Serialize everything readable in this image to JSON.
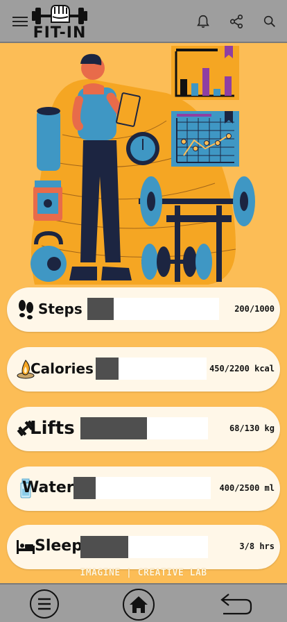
{
  "app": {
    "title": "FIT-IN",
    "footer": "IMAGINE | CREATIVE LAB"
  },
  "colors": {
    "background": "#fcbd56",
    "bar": "#9e9e9e",
    "card": "#fff7e8",
    "fill": "#4f4f4f",
    "accent_blue": "#3f97c4",
    "accent_navy": "#1c2541",
    "accent_purple": "#8e3fa3"
  },
  "top_icons": [
    "hamburger-menu-icon",
    "bell-icon",
    "share-icon",
    "search-icon"
  ],
  "metrics": [
    {
      "key": "steps",
      "label": "Steps",
      "value": "200/1000",
      "current": 200,
      "goal": 1000,
      "icon": "footprints-icon"
    },
    {
      "key": "calories",
      "label": "Calories",
      "value": "450/2200 kcal",
      "current": 450,
      "goal": 2200,
      "icon": "flame-icon"
    },
    {
      "key": "lifts",
      "label": "Lifts",
      "value": "68/130 kg",
      "current": 68,
      "goal": 130,
      "icon": "dumbbell-icon"
    },
    {
      "key": "water",
      "label": "Water",
      "value": "400/2500 ml",
      "current": 400,
      "goal": 2500,
      "icon": "water-bottle-icon"
    },
    {
      "key": "sleep",
      "label": "Sleep",
      "value": "3/8 hrs",
      "current": 3,
      "goal": 8,
      "icon": "bed-icon"
    }
  ],
  "bottom_nav": [
    "menu-circle-icon",
    "home-icon",
    "back-arrow-icon"
  ]
}
